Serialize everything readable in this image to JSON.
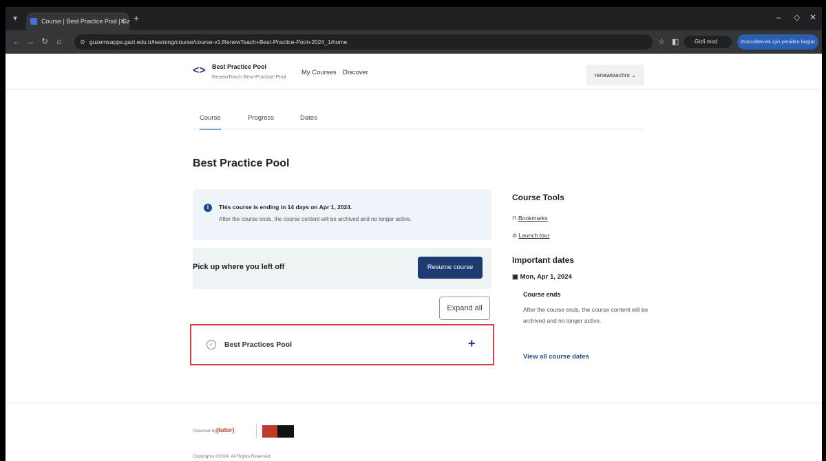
{
  "browser": {
    "tab_title": "Course | Best Practice Pool | Gz…",
    "url": "guzemsapps.gazi.edu.tr/learning/course/course-v1:RenewTeach+Best-Practice-Pool+2024_1/home",
    "guest_label": "Gizli mod",
    "update_label": "Güncellemek için yeniden başlat"
  },
  "header": {
    "course_name": "Best Practice Pool",
    "course_sub": "RenewTeach Best-Practice-Pool",
    "nav": [
      "My Courses",
      "Discover"
    ],
    "user": "renewteachrs"
  },
  "tabs": [
    "Course",
    "Progress",
    "Dates"
  ],
  "main": {
    "title": "Best Practice Pool",
    "alert_line1": "This course is ending in 14 days on Apr 1, 2024.",
    "alert_line2": "After the course ends, the course content will be archived and no longer active.",
    "resume_label": "Pick up where you left off",
    "resume_button": "Resume course",
    "expand_button": "Expand all",
    "section_name": "Best Practices Pool"
  },
  "sidebar": {
    "tools_title": "Course Tools",
    "bookmarks": "Bookmarks",
    "launch_tour": "Launch tour",
    "dates_title": "Important dates",
    "date": "Mon, Apr 1, 2024",
    "ends_label": "Course ends",
    "ends_desc": "After the course ends, the course content will be archived and no longer active.",
    "view_all": "View all course dates"
  },
  "footer": {
    "powered_by": "Powered by",
    "tutor": "(tutor)",
    "copyright": "Copyrights ©2024. All Rights Reserved."
  }
}
